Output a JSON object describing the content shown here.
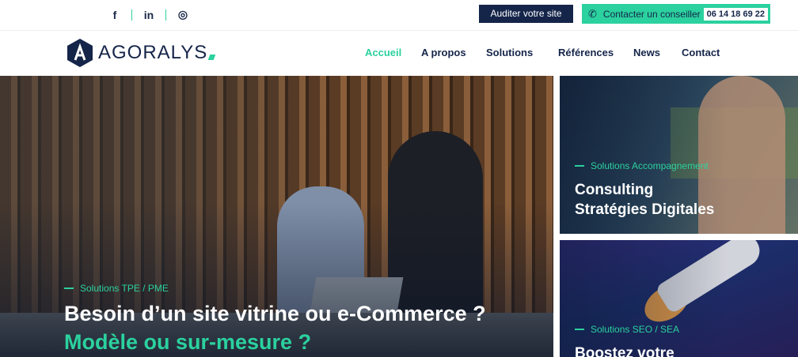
{
  "topbar": {
    "social": {
      "facebook": "f",
      "linkedin": "in",
      "instagram": "◎"
    },
    "audit_label": "Auditer votre site",
    "contact_label": "Contacter un conseiller",
    "phone": "06 14 18 69 22"
  },
  "brand": {
    "name": "AGORALYS"
  },
  "nav": {
    "items": [
      "Accueil",
      "A propos",
      "Solutions",
      "Références",
      "News",
      "Contact"
    ],
    "active": "Accueil"
  },
  "hero": {
    "category": "Solutions TPE / PME",
    "title_line1": "Besoin d’un site vitrine ou e-Commerce ?",
    "title_line2": "Modèle ou sur-mesure ?"
  },
  "cards": [
    {
      "category": "Solutions Accompagnement",
      "title_line1": "Consulting",
      "title_line2": "Stratégies Digitales"
    },
    {
      "category": "Solutions SEO / SEA",
      "title_line1": "Boostez votre",
      "title_line2": ""
    }
  ],
  "colors": {
    "navy": "#15254a",
    "accent": "#2bd19e"
  }
}
